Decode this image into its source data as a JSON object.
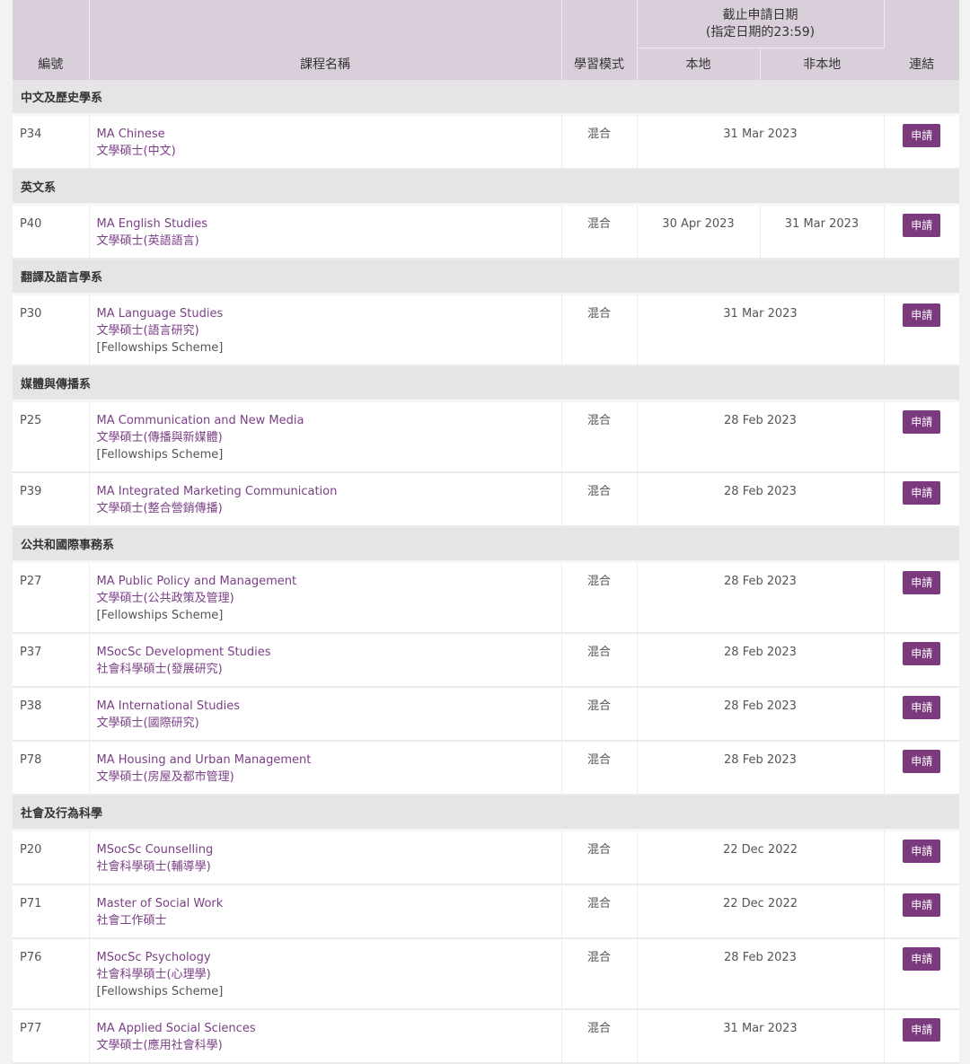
{
  "header": {
    "code": "編號",
    "course_name": "課程名稱",
    "mode": "學習模式",
    "deadline_line1": "截止申請日期",
    "deadline_line2": "(指定日期的23:59)",
    "local": "本地",
    "non_local": "非本地",
    "link": "連結"
  },
  "apply_label": "申請",
  "departments": [
    {
      "name": "中文及歷史學系",
      "courses": [
        {
          "code": "P34",
          "en": "MA Chinese",
          "zh": "文學碩士(中文)",
          "note": "",
          "mode": "混合",
          "local": "31 Mar 2023",
          "non_local": ""
        }
      ]
    },
    {
      "name": "英文系",
      "courses": [
        {
          "code": "P40",
          "en": "MA English Studies",
          "zh": "文學碩士(英語語言)",
          "note": "",
          "mode": "混合",
          "local": "30 Apr 2023",
          "non_local": "31 Mar 2023"
        }
      ]
    },
    {
      "name": "翻譯及語言學系",
      "courses": [
        {
          "code": "P30",
          "en": "MA Language Studies",
          "zh": "文學碩士(語言研究)",
          "note": "[Fellowships Scheme]",
          "mode": "混合",
          "local": "31 Mar 2023",
          "non_local": ""
        }
      ]
    },
    {
      "name": "媒體與傳播系",
      "courses": [
        {
          "code": "P25",
          "en": "MA Communication and New Media",
          "zh": "文學碩士(傳播與新媒體)",
          "note": "[Fellowships Scheme]",
          "mode": "混合",
          "local": "28 Feb 2023",
          "non_local": ""
        },
        {
          "code": "P39",
          "en": "MA Integrated Marketing Communication",
          "zh": "文學碩士(整合營銷傳播)",
          "note": "",
          "mode": "混合",
          "local": "28 Feb 2023",
          "non_local": ""
        }
      ]
    },
    {
      "name": "公共和國際事務系",
      "courses": [
        {
          "code": "P27",
          "en": "MA Public Policy and Management",
          "zh": "文學碩士(公共政策及管理)",
          "note": "[Fellowships Scheme]",
          "mode": "混合",
          "local": "28 Feb 2023",
          "non_local": ""
        },
        {
          "code": "P37",
          "en": "MSocSc Development Studies",
          "zh": "社會科學碩士(發展研究)",
          "note": "",
          "mode": "混合",
          "local": "28 Feb 2023",
          "non_local": ""
        },
        {
          "code": "P38",
          "en": "MA International Studies",
          "zh": "文學碩士(國際研究)",
          "note": "",
          "mode": "混合",
          "local": "28 Feb 2023",
          "non_local": ""
        },
        {
          "code": "P78",
          "en": "MA Housing and Urban Management",
          "zh": "文學碩士(房屋及都市管理)",
          "note": "",
          "mode": "混合",
          "local": "28 Feb 2023",
          "non_local": ""
        }
      ]
    },
    {
      "name": "社會及行為科學",
      "courses": [
        {
          "code": "P20",
          "en": "MSocSc Counselling",
          "zh": "社會科學碩士(輔導學)",
          "note": "",
          "mode": "混合",
          "local": "22 Dec 2022",
          "non_local": ""
        },
        {
          "code": "P71",
          "en": "Master of Social Work",
          "zh": "社會工作碩士",
          "note": "",
          "mode": "混合",
          "local": "22 Dec 2022",
          "non_local": ""
        },
        {
          "code": "P76",
          "en": "MSocSc Psychology",
          "zh": "社會科學碩士(心理學)",
          "note": "[Fellowships Scheme]",
          "mode": "混合",
          "local": "28 Feb 2023",
          "non_local": ""
        },
        {
          "code": "P77",
          "en": "MA Applied Social Sciences",
          "zh": "文學碩士(應用社會科學)",
          "note": "",
          "mode": "混合",
          "local": "31 Mar 2023",
          "non_local": ""
        }
      ]
    }
  ]
}
